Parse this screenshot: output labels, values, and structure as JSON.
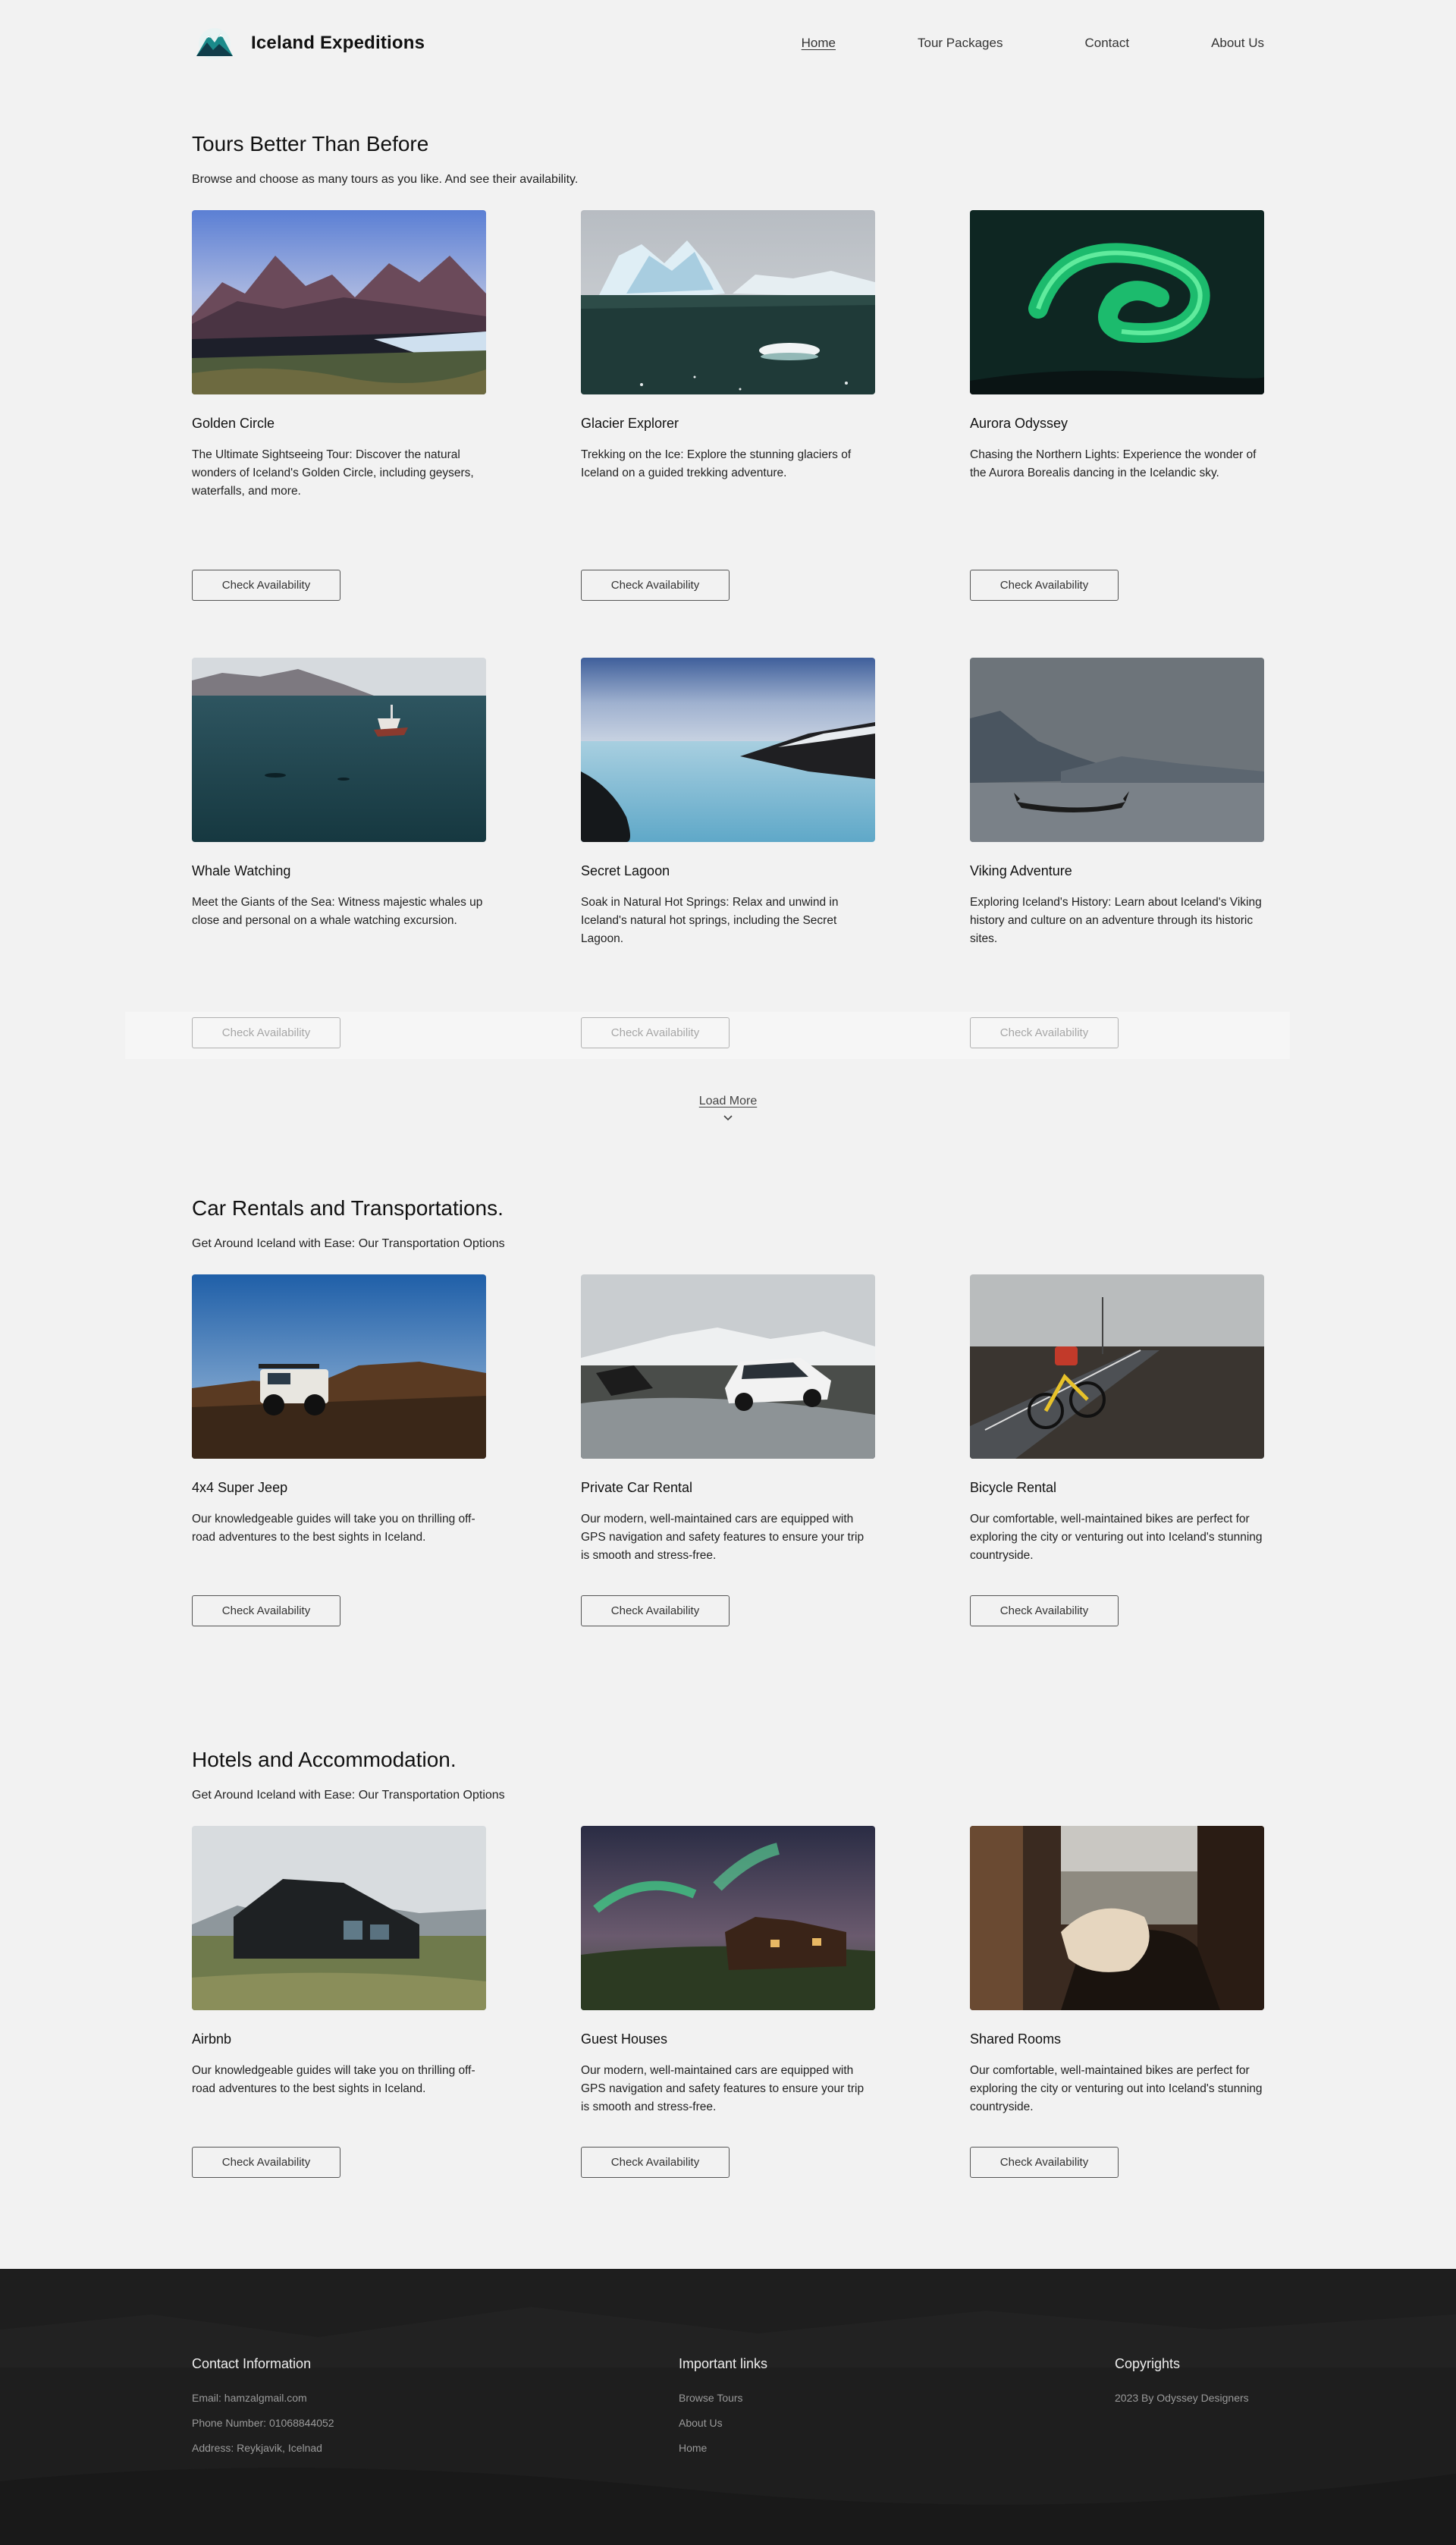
{
  "header": {
    "brand": "Iceland Expeditions",
    "nav": [
      "Home",
      "Tour Packages",
      "Contact",
      "About Us"
    ],
    "active_nav": "Home"
  },
  "tours": {
    "title": "Tours Better Than Before",
    "subtitle": "Browse and choose as many tours as you like. And see their availability.",
    "items": [
      {
        "title": "Golden Circle",
        "desc": "The Ultimate Sightseeing Tour: Discover the natural wonders of Iceland's Golden Circle, including geysers, waterfalls, and more.",
        "button": "Check Availability"
      },
      {
        "title": "Glacier Explorer",
        "desc": "Trekking on the Ice: Explore the stunning glaciers of Iceland on a guided trekking adventure.",
        "button": "Check Availability"
      },
      {
        "title": "Aurora Odyssey",
        "desc": "Chasing the Northern Lights: Experience the wonder of the Aurora Borealis dancing in the Icelandic sky.",
        "button": "Check Availability"
      },
      {
        "title": "Whale Watching",
        "desc": " Meet the Giants of the Sea: Witness majestic whales up close and personal on a whale watching excursion.",
        "button": "Check Availability"
      },
      {
        "title": "Secret Lagoon",
        "desc": "Soak in Natural Hot Springs: Relax and unwind in Iceland's natural hot springs, including the Secret Lagoon.",
        "button": "Check Availability"
      },
      {
        "title": "Viking Adventure",
        "desc": "Exploring Iceland's History: Learn about Iceland's Viking history and culture on an adventure through its historic sites.",
        "button": "Check Availability"
      }
    ],
    "load_more": "Load More"
  },
  "transport": {
    "title": "Car Rentals and Transportations.",
    "subtitle": "Get Around Iceland with Ease: Our Transportation Options",
    "items": [
      {
        "title": "4x4 Super Jeep",
        "desc": "Our knowledgeable guides will take you on thrilling off-road adventures to the best sights in Iceland.",
        "button": "Check Availability"
      },
      {
        "title": "Private Car Rental",
        "desc": "Our modern, well-maintained cars are equipped with GPS navigation and safety features to ensure your trip is smooth and stress-free.",
        "button": "Check Availability"
      },
      {
        "title": "Bicycle Rental",
        "desc": "Our comfortable, well-maintained bikes are perfect for exploring the city or venturing out into Iceland's stunning countryside.",
        "button": "Check Availability"
      }
    ]
  },
  "hotels": {
    "title": "Hotels and Accommodation.",
    "subtitle": "Get Around Iceland with Ease: Our Transportation Options",
    "items": [
      {
        "title": "Airbnb",
        "desc": "Our knowledgeable guides will take you on thrilling off-road adventures to the best sights in Iceland.",
        "button": "Check Availability"
      },
      {
        "title": "Guest Houses",
        "desc": "Our modern, well-maintained cars are equipped with GPS navigation and safety features to ensure your trip is smooth and stress-free.",
        "button": "Check Availability"
      },
      {
        "title": "Shared Rooms",
        "desc": "Our comfortable, well-maintained bikes are perfect for exploring the city or venturing out into Iceland's stunning countryside.",
        "button": "Check Availability"
      }
    ]
  },
  "footer": {
    "contact": {
      "title": "Contact Information",
      "lines": [
        "Email: hamzalgmail.com",
        "Phone Number: 01068844052",
        "Address: Reykjavik, Icelnad"
      ]
    },
    "links": {
      "title": "Important links",
      "lines": [
        "Browse Tours",
        "About Us",
        "Home"
      ]
    },
    "copyright": {
      "title": "Copyrights",
      "lines": [
        "2023 By Odyssey Designers"
      ]
    }
  },
  "colors": {
    "page_bg": "#f2f2f2",
    "footer_bg": "#1d1d1d",
    "logo_teal": "#1a8a8a",
    "button_border": "#555555"
  }
}
